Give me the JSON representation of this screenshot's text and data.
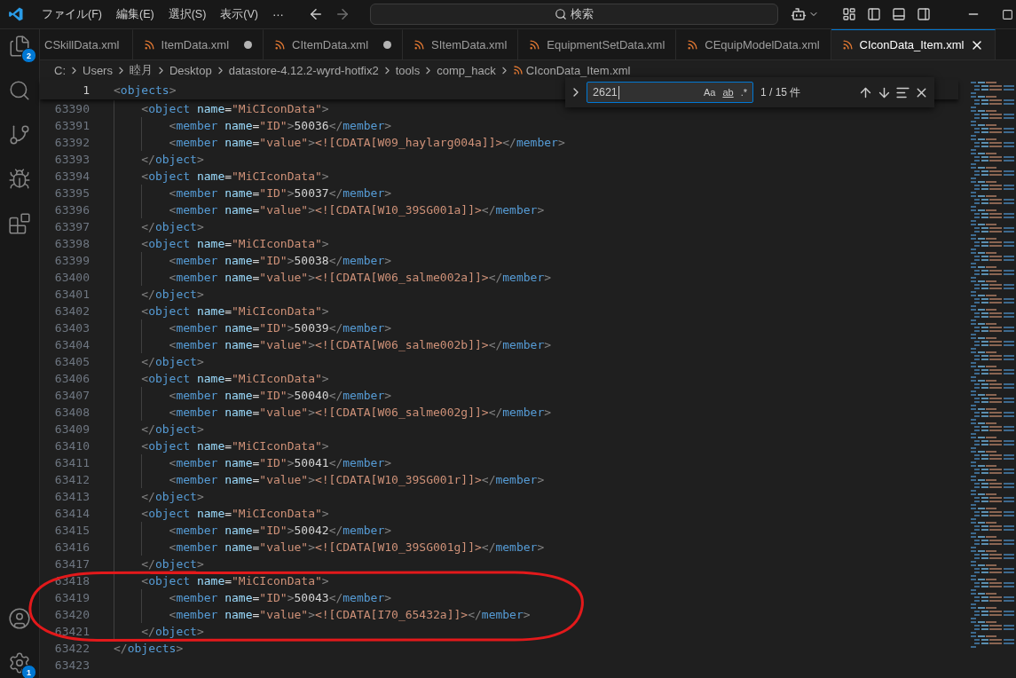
{
  "menu": [
    {
      "label": "ファイル(F)"
    },
    {
      "label": "編集(E)"
    },
    {
      "label": "選択(S)"
    },
    {
      "label": "表示(V)"
    },
    {
      "label": "⋯"
    }
  ],
  "search": {
    "placeholder": "検索"
  },
  "activity_bar": {
    "top": [
      {
        "kind": "explorer",
        "badge": "2"
      },
      {
        "kind": "search"
      },
      {
        "kind": "source-control"
      },
      {
        "kind": "debug"
      },
      {
        "kind": "extensions"
      }
    ],
    "bottom": [
      {
        "kind": "account"
      },
      {
        "kind": "settings",
        "badge": "1"
      }
    ]
  },
  "tabs": [
    {
      "label": "CSkillData.xml",
      "has_icon": false,
      "modified": false,
      "selected": false
    },
    {
      "label": "ItemData.xml",
      "has_icon": true,
      "modified": true,
      "selected": false
    },
    {
      "label": "CItemData.xml",
      "has_icon": true,
      "modified": true,
      "selected": false
    },
    {
      "label": "SItemData.xml",
      "has_icon": true,
      "modified": false,
      "selected": false
    },
    {
      "label": "EquipmentSetData.xml",
      "has_icon": true,
      "modified": false,
      "selected": false
    },
    {
      "label": "CEquipModelData.xml",
      "has_icon": true,
      "modified": false,
      "selected": false
    },
    {
      "label": "CIconData_Item.xml",
      "has_icon": true,
      "modified": false,
      "selected": true
    }
  ],
  "breadcrumbs": [
    {
      "label": "C:",
      "kind": "folder"
    },
    {
      "label": "Users",
      "kind": "folder"
    },
    {
      "label": "睦月",
      "kind": "folder"
    },
    {
      "label": "Desktop",
      "kind": "folder"
    },
    {
      "label": "datastore-4.12.2-wyrd-hotfix2",
      "kind": "folder"
    },
    {
      "label": "tools",
      "kind": "folder"
    },
    {
      "label": "comp_hack",
      "kind": "folder"
    },
    {
      "label": "CIconData_Item.xml",
      "kind": "file"
    }
  ],
  "find": {
    "query": "2621",
    "options": [
      {
        "label": "Aa",
        "selected": false
      },
      {
        "label": "ab",
        "selected": false
      },
      {
        "label": ".*",
        "selected": false
      }
    ],
    "result": "1 / 15 件"
  },
  "editor": {
    "sticky": {
      "number": "1",
      "tokens": [
        {
          "kind": "punct",
          "text": "<"
        },
        {
          "kind": "tag",
          "text": "objects"
        },
        {
          "kind": "punct",
          "text": ">"
        }
      ],
      "children": [
        {
          "number": "63390",
          "tokens": [
            {
              "kind": "punct",
              "text": "<"
            },
            {
              "kind": "tag",
              "text": "object"
            },
            {
              "kind": "attr",
              "text": "name"
            },
            {
              "kind": "op",
              "text": "="
            },
            {
              "kind": "string",
              "text": "\"MiCIconData\""
            },
            {
              "kind": "punct",
              "text": ">"
            }
          ],
          "children": [
            {
              "number": "63391",
              "tokens": [
                {
                  "kind": "punct",
                  "text": "<"
                },
                {
                  "kind": "tag",
                  "text": "member"
                },
                {
                  "kind": "attr",
                  "text": "name"
                },
                {
                  "kind": "op",
                  "text": "="
                },
                {
                  "kind": "string",
                  "text": "\"ID\""
                },
                {
                  "kind": "punct",
                  "text": ">"
                },
                {
                  "kind": "text",
                  "text": "50036"
                },
                {
                  "kind": "punct",
                  "text": "</"
                },
                {
                  "kind": "tag",
                  "text": "member"
                },
                {
                  "kind": "punct",
                  "text": ">"
                }
              ]
            },
            {
              "number": "63392",
              "tokens": [
                {
                  "kind": "punct",
                  "text": "<"
                },
                {
                  "kind": "tag",
                  "text": "member"
                },
                {
                  "kind": "attr",
                  "text": "name"
                },
                {
                  "kind": "op",
                  "text": "="
                },
                {
                  "kind": "string",
                  "text": "\"value\""
                },
                {
                  "kind": "punct",
                  "text": ">"
                },
                {
                  "kind": "cdata",
                  "text": "<![CDATA[W09_haylarg004a]]>"
                },
                {
                  "kind": "punct",
                  "text": "</"
                },
                {
                  "kind": "tag",
                  "text": "member"
                },
                {
                  "kind": "punct",
                  "text": ">"
                }
              ]
            }
          ]
        },
        {
          "number": "63393",
          "tokens": [
            {
              "kind": "punct",
              "text": "</"
            },
            {
              "kind": "tag",
              "text": "object"
            },
            {
              "kind": "punct",
              "text": ">"
            }
          ]
        },
        {
          "number": "63394",
          "tokens": [
            {
              "kind": "punct",
              "text": "<"
            },
            {
              "kind": "tag",
              "text": "object"
            },
            {
              "kind": "attr",
              "text": "name"
            },
            {
              "kind": "op",
              "text": "="
            },
            {
              "kind": "string",
              "text": "\"MiCIconData\""
            },
            {
              "kind": "punct",
              "text": ">"
            }
          ],
          "children": [
            {
              "number": "63395",
              "tokens": [
                {
                  "kind": "punct",
                  "text": "<"
                },
                {
                  "kind": "tag",
                  "text": "member"
                },
                {
                  "kind": "attr",
                  "text": "name"
                },
                {
                  "kind": "op",
                  "text": "="
                },
                {
                  "kind": "string",
                  "text": "\"ID\""
                },
                {
                  "kind": "punct",
                  "text": ">"
                },
                {
                  "kind": "text",
                  "text": "50037"
                },
                {
                  "kind": "punct",
                  "text": "</"
                },
                {
                  "kind": "tag",
                  "text": "member"
                },
                {
                  "kind": "punct",
                  "text": ">"
                }
              ]
            },
            {
              "number": "63396",
              "tokens": [
                {
                  "kind": "punct",
                  "text": "<"
                },
                {
                  "kind": "tag",
                  "text": "member"
                },
                {
                  "kind": "attr",
                  "text": "name"
                },
                {
                  "kind": "op",
                  "text": "="
                },
                {
                  "kind": "string",
                  "text": "\"value\""
                },
                {
                  "kind": "punct",
                  "text": ">"
                },
                {
                  "kind": "cdata",
                  "text": "<![CDATA[W10_39SG001a]]>"
                },
                {
                  "kind": "punct",
                  "text": "</"
                },
                {
                  "kind": "tag",
                  "text": "member"
                },
                {
                  "kind": "punct",
                  "text": ">"
                }
              ]
            }
          ]
        },
        {
          "number": "63397",
          "tokens": [
            {
              "kind": "punct",
              "text": "</"
            },
            {
              "kind": "tag",
              "text": "object"
            },
            {
              "kind": "punct",
              "text": ">"
            }
          ]
        },
        {
          "number": "63398",
          "tokens": [
            {
              "kind": "punct",
              "text": "<"
            },
            {
              "kind": "tag",
              "text": "object"
            },
            {
              "kind": "attr",
              "text": "name"
            },
            {
              "kind": "op",
              "text": "="
            },
            {
              "kind": "string",
              "text": "\"MiCIconData\""
            },
            {
              "kind": "punct",
              "text": ">"
            }
          ],
          "children": [
            {
              "number": "63399",
              "tokens": [
                {
                  "kind": "punct",
                  "text": "<"
                },
                {
                  "kind": "tag",
                  "text": "member"
                },
                {
                  "kind": "attr",
                  "text": "name"
                },
                {
                  "kind": "op",
                  "text": "="
                },
                {
                  "kind": "string",
                  "text": "\"ID\""
                },
                {
                  "kind": "punct",
                  "text": ">"
                },
                {
                  "kind": "text",
                  "text": "50038"
                },
                {
                  "kind": "punct",
                  "text": "</"
                },
                {
                  "kind": "tag",
                  "text": "member"
                },
                {
                  "kind": "punct",
                  "text": ">"
                }
              ]
            },
            {
              "number": "63400",
              "tokens": [
                {
                  "kind": "punct",
                  "text": "<"
                },
                {
                  "kind": "tag",
                  "text": "member"
                },
                {
                  "kind": "attr",
                  "text": "name"
                },
                {
                  "kind": "op",
                  "text": "="
                },
                {
                  "kind": "string",
                  "text": "\"value\""
                },
                {
                  "kind": "punct",
                  "text": ">"
                },
                {
                  "kind": "cdata",
                  "text": "<![CDATA[W06_salme002a]]>"
                },
                {
                  "kind": "punct",
                  "text": "</"
                },
                {
                  "kind": "tag",
                  "text": "member"
                },
                {
                  "kind": "punct",
                  "text": ">"
                }
              ]
            }
          ]
        },
        {
          "number": "63401",
          "tokens": [
            {
              "kind": "punct",
              "text": "</"
            },
            {
              "kind": "tag",
              "text": "object"
            },
            {
              "kind": "punct",
              "text": ">"
            }
          ]
        },
        {
          "number": "63402",
          "tokens": [
            {
              "kind": "punct",
              "text": "<"
            },
            {
              "kind": "tag",
              "text": "object"
            },
            {
              "kind": "attr",
              "text": "name"
            },
            {
              "kind": "op",
              "text": "="
            },
            {
              "kind": "string",
              "text": "\"MiCIconData\""
            },
            {
              "kind": "punct",
              "text": ">"
            }
          ],
          "children": [
            {
              "number": "63403",
              "tokens": [
                {
                  "kind": "punct",
                  "text": "<"
                },
                {
                  "kind": "tag",
                  "text": "member"
                },
                {
                  "kind": "attr",
                  "text": "name"
                },
                {
                  "kind": "op",
                  "text": "="
                },
                {
                  "kind": "string",
                  "text": "\"ID\""
                },
                {
                  "kind": "punct",
                  "text": ">"
                },
                {
                  "kind": "text",
                  "text": "50039"
                },
                {
                  "kind": "punct",
                  "text": "</"
                },
                {
                  "kind": "tag",
                  "text": "member"
                },
                {
                  "kind": "punct",
                  "text": ">"
                }
              ]
            },
            {
              "number": "63404",
              "tokens": [
                {
                  "kind": "punct",
                  "text": "<"
                },
                {
                  "kind": "tag",
                  "text": "member"
                },
                {
                  "kind": "attr",
                  "text": "name"
                },
                {
                  "kind": "op",
                  "text": "="
                },
                {
                  "kind": "string",
                  "text": "\"value\""
                },
                {
                  "kind": "punct",
                  "text": ">"
                },
                {
                  "kind": "cdata",
                  "text": "<![CDATA[W06_salme002b]]>"
                },
                {
                  "kind": "punct",
                  "text": "</"
                },
                {
                  "kind": "tag",
                  "text": "member"
                },
                {
                  "kind": "punct",
                  "text": ">"
                }
              ]
            }
          ]
        },
        {
          "number": "63405",
          "tokens": [
            {
              "kind": "punct",
              "text": "</"
            },
            {
              "kind": "tag",
              "text": "object"
            },
            {
              "kind": "punct",
              "text": ">"
            }
          ]
        },
        {
          "number": "63406",
          "tokens": [
            {
              "kind": "punct",
              "text": "<"
            },
            {
              "kind": "tag",
              "text": "object"
            },
            {
              "kind": "attr",
              "text": "name"
            },
            {
              "kind": "op",
              "text": "="
            },
            {
              "kind": "string",
              "text": "\"MiCIconData\""
            },
            {
              "kind": "punct",
              "text": ">"
            }
          ],
          "children": [
            {
              "number": "63407",
              "tokens": [
                {
                  "kind": "punct",
                  "text": "<"
                },
                {
                  "kind": "tag",
                  "text": "member"
                },
                {
                  "kind": "attr",
                  "text": "name"
                },
                {
                  "kind": "op",
                  "text": "="
                },
                {
                  "kind": "string",
                  "text": "\"ID\""
                },
                {
                  "kind": "punct",
                  "text": ">"
                },
                {
                  "kind": "text",
                  "text": "50040"
                },
                {
                  "kind": "punct",
                  "text": "</"
                },
                {
                  "kind": "tag",
                  "text": "member"
                },
                {
                  "kind": "punct",
                  "text": ">"
                }
              ]
            },
            {
              "number": "63408",
              "tokens": [
                {
                  "kind": "punct",
                  "text": "<"
                },
                {
                  "kind": "tag",
                  "text": "member"
                },
                {
                  "kind": "attr",
                  "text": "name"
                },
                {
                  "kind": "op",
                  "text": "="
                },
                {
                  "kind": "string",
                  "text": "\"value\""
                },
                {
                  "kind": "punct",
                  "text": ">"
                },
                {
                  "kind": "cdata",
                  "text": "<![CDATA[W06_salme002g]]>"
                },
                {
                  "kind": "punct",
                  "text": "</"
                },
                {
                  "kind": "tag",
                  "text": "member"
                },
                {
                  "kind": "punct",
                  "text": ">"
                }
              ]
            }
          ]
        },
        {
          "number": "63409",
          "tokens": [
            {
              "kind": "punct",
              "text": "</"
            },
            {
              "kind": "tag",
              "text": "object"
            },
            {
              "kind": "punct",
              "text": ">"
            }
          ]
        },
        {
          "number": "63410",
          "tokens": [
            {
              "kind": "punct",
              "text": "<"
            },
            {
              "kind": "tag",
              "text": "object"
            },
            {
              "kind": "attr",
              "text": "name"
            },
            {
              "kind": "op",
              "text": "="
            },
            {
              "kind": "string",
              "text": "\"MiCIconData\""
            },
            {
              "kind": "punct",
              "text": ">"
            }
          ],
          "children": [
            {
              "number": "63411",
              "tokens": [
                {
                  "kind": "punct",
                  "text": "<"
                },
                {
                  "kind": "tag",
                  "text": "member"
                },
                {
                  "kind": "attr",
                  "text": "name"
                },
                {
                  "kind": "op",
                  "text": "="
                },
                {
                  "kind": "string",
                  "text": "\"ID\""
                },
                {
                  "kind": "punct",
                  "text": ">"
                },
                {
                  "kind": "text",
                  "text": "50041"
                },
                {
                  "kind": "punct",
                  "text": "</"
                },
                {
                  "kind": "tag",
                  "text": "member"
                },
                {
                  "kind": "punct",
                  "text": ">"
                }
              ]
            },
            {
              "number": "63412",
              "tokens": [
                {
                  "kind": "punct",
                  "text": "<"
                },
                {
                  "kind": "tag",
                  "text": "member"
                },
                {
                  "kind": "attr",
                  "text": "name"
                },
                {
                  "kind": "op",
                  "text": "="
                },
                {
                  "kind": "string",
                  "text": "\"value\""
                },
                {
                  "kind": "punct",
                  "text": ">"
                },
                {
                  "kind": "cdata",
                  "text": "<![CDATA[W10_39SG001r]]>"
                },
                {
                  "kind": "punct",
                  "text": "</"
                },
                {
                  "kind": "tag",
                  "text": "member"
                },
                {
                  "kind": "punct",
                  "text": ">"
                }
              ]
            }
          ]
        },
        {
          "number": "63413",
          "tokens": [
            {
              "kind": "punct",
              "text": "</"
            },
            {
              "kind": "tag",
              "text": "object"
            },
            {
              "kind": "punct",
              "text": ">"
            }
          ]
        },
        {
          "number": "63414",
          "tokens": [
            {
              "kind": "punct",
              "text": "<"
            },
            {
              "kind": "tag",
              "text": "object"
            },
            {
              "kind": "attr",
              "text": "name"
            },
            {
              "kind": "op",
              "text": "="
            },
            {
              "kind": "string",
              "text": "\"MiCIconData\""
            },
            {
              "kind": "punct",
              "text": ">"
            }
          ],
          "children": [
            {
              "number": "63415",
              "tokens": [
                {
                  "kind": "punct",
                  "text": "<"
                },
                {
                  "kind": "tag",
                  "text": "member"
                },
                {
                  "kind": "attr",
                  "text": "name"
                },
                {
                  "kind": "op",
                  "text": "="
                },
                {
                  "kind": "string",
                  "text": "\"ID\""
                },
                {
                  "kind": "punct",
                  "text": ">"
                },
                {
                  "kind": "text",
                  "text": "50042"
                },
                {
                  "kind": "punct",
                  "text": "</"
                },
                {
                  "kind": "tag",
                  "text": "member"
                },
                {
                  "kind": "punct",
                  "text": ">"
                }
              ]
            },
            {
              "number": "63416",
              "tokens": [
                {
                  "kind": "punct",
                  "text": "<"
                },
                {
                  "kind": "tag",
                  "text": "member"
                },
                {
                  "kind": "attr",
                  "text": "name"
                },
                {
                  "kind": "op",
                  "text": "="
                },
                {
                  "kind": "string",
                  "text": "\"value\""
                },
                {
                  "kind": "punct",
                  "text": ">"
                },
                {
                  "kind": "cdata",
                  "text": "<![CDATA[W10_39SG001g]]>"
                },
                {
                  "kind": "punct",
                  "text": "</"
                },
                {
                  "kind": "tag",
                  "text": "member"
                },
                {
                  "kind": "punct",
                  "text": ">"
                }
              ]
            }
          ]
        },
        {
          "number": "63417",
          "tokens": [
            {
              "kind": "punct",
              "text": "</"
            },
            {
              "kind": "tag",
              "text": "object"
            },
            {
              "kind": "punct",
              "text": ">"
            }
          ]
        },
        {
          "number": "63418",
          "tokens": [
            {
              "kind": "punct",
              "text": "<"
            },
            {
              "kind": "tag",
              "text": "object"
            },
            {
              "kind": "attr",
              "text": "name"
            },
            {
              "kind": "op",
              "text": "="
            },
            {
              "kind": "string",
              "text": "\"MiCIconData\""
            },
            {
              "kind": "punct",
              "text": ">"
            }
          ],
          "children": [
            {
              "number": "63419",
              "tokens": [
                {
                  "kind": "punct",
                  "text": "<"
                },
                {
                  "kind": "tag",
                  "text": "member"
                },
                {
                  "kind": "attr",
                  "text": "name"
                },
                {
                  "kind": "op",
                  "text": "="
                },
                {
                  "kind": "string",
                  "text": "\"ID\""
                },
                {
                  "kind": "punct",
                  "text": ">"
                },
                {
                  "kind": "text",
                  "text": "50043"
                },
                {
                  "kind": "punct",
                  "text": "</"
                },
                {
                  "kind": "tag",
                  "text": "member"
                },
                {
                  "kind": "punct",
                  "text": ">"
                }
              ]
            },
            {
              "number": "63420",
              "tokens": [
                {
                  "kind": "punct",
                  "text": "<"
                },
                {
                  "kind": "tag",
                  "text": "member"
                },
                {
                  "kind": "attr",
                  "text": "name"
                },
                {
                  "kind": "op",
                  "text": "="
                },
                {
                  "kind": "string",
                  "text": "\"value\""
                },
                {
                  "kind": "punct",
                  "text": ">"
                },
                {
                  "kind": "cdata",
                  "text": "<![CDATA[I70_65432a]]>"
                },
                {
                  "kind": "punct",
                  "text": "</"
                },
                {
                  "kind": "tag",
                  "text": "member"
                },
                {
                  "kind": "punct",
                  "text": ">"
                }
              ]
            }
          ]
        },
        {
          "number": "63421",
          "tokens": [
            {
              "kind": "punct",
              "text": "</"
            },
            {
              "kind": "tag",
              "text": "object"
            },
            {
              "kind": "punct",
              "text": ">"
            }
          ]
        }
      ]
    },
    "trailing_lines": [
      {
        "number": "63422",
        "tokens": [
          {
            "kind": "punct",
            "text": "</"
          },
          {
            "kind": "tag",
            "text": "objects"
          },
          {
            "kind": "punct",
            "text": ">"
          }
        ]
      },
      {
        "number": "63423"
      }
    ]
  },
  "annotation": {
    "kind": "freehand-ellipse"
  }
}
